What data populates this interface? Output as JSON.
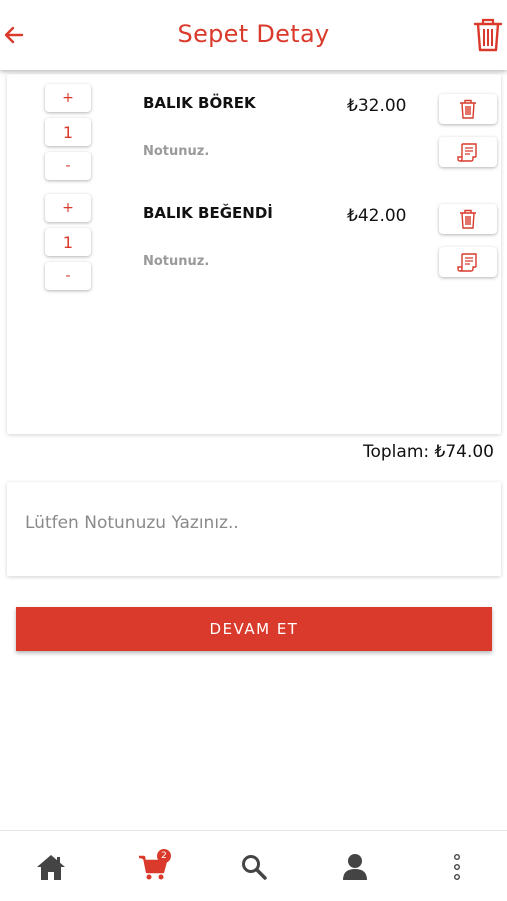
{
  "header": {
    "title": "Sepet Detay",
    "back_icon": "arrow-left-icon",
    "clear_icon": "trash-icon"
  },
  "cart": {
    "items": [
      {
        "increment_label": "+",
        "quantity": "1",
        "decrement_label": "-",
        "name": "BALIK BÖREK",
        "price": "₺32.00",
        "note": "Notunuz."
      },
      {
        "increment_label": "+",
        "quantity": "1",
        "decrement_label": "-",
        "name": "BALIK BEĞENDİ",
        "price": "₺42.00",
        "note": "Notunuz."
      }
    ],
    "total_label": "Toplam: ₺74.00"
  },
  "order_note": {
    "placeholder": "Lütfen Notunuzu Yazınız..",
    "value": ""
  },
  "continue_button": {
    "label": "DEVAM ET"
  },
  "bottom_nav": {
    "items": [
      {
        "icon": "home-icon"
      },
      {
        "icon": "cart-icon",
        "badge": "2"
      },
      {
        "icon": "search-icon"
      },
      {
        "icon": "user-icon"
      },
      {
        "icon": "more-vertical-icon"
      }
    ]
  },
  "colors": {
    "accent": "#d93a2b",
    "text": "#111111",
    "muted": "#9a9a9a"
  }
}
